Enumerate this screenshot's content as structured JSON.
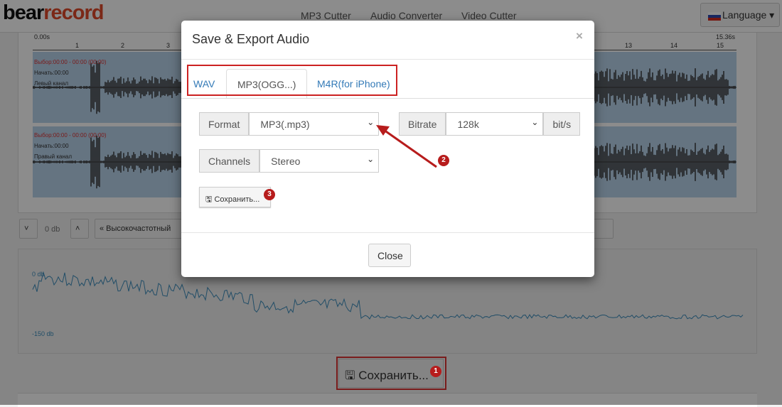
{
  "header": {
    "logo": "bearrecord",
    "logo_parts": [
      "bear",
      "record"
    ],
    "nav": [
      "MP3 Cutter",
      "Audio Converter",
      "Video Cutter"
    ],
    "language": "Language"
  },
  "waveform": {
    "ruler_start": "0.00s",
    "ruler_end": "15.36s",
    "ticks": [
      "1",
      "2",
      "3",
      "13",
      "14",
      "15"
    ],
    "tracks": [
      {
        "selection": "Выбор:00:00 - 00:00 (00:00)",
        "start": "Начать:00:00",
        "channel": "Левый канал"
      },
      {
        "selection": "Выбор:00:00 - 00:00 (00:00)",
        "start": "Начать:00:00",
        "channel": "Правый канал"
      }
    ]
  },
  "toolbar": {
    "down": "˅",
    "gain": "0 db",
    "up": "˄",
    "filter": "« Высокочастотный"
  },
  "spectrum": {
    "top_label": "0 db",
    "bottom_label": "-150 db",
    "line_color": "#3c8dbc"
  },
  "save_button": "Сохранить...",
  "modal": {
    "title": "Save & Export Audio",
    "close_x": "×",
    "tabs": [
      {
        "label": "WAV"
      },
      {
        "label": "MP3(OGG...)",
        "active": true
      },
      {
        "label": "M4R(for iPhone)"
      }
    ],
    "format": {
      "label": "Format",
      "value": "MP3(.mp3)"
    },
    "bitrate": {
      "label": "Bitrate",
      "value": "128k",
      "unit": "bit/s"
    },
    "channels": {
      "label": "Channels",
      "value": "Stereo"
    },
    "save": "Сохранить...",
    "close": "Close"
  },
  "annotations": {
    "badges": [
      "1",
      "2",
      "3"
    ],
    "color": "#c22"
  }
}
